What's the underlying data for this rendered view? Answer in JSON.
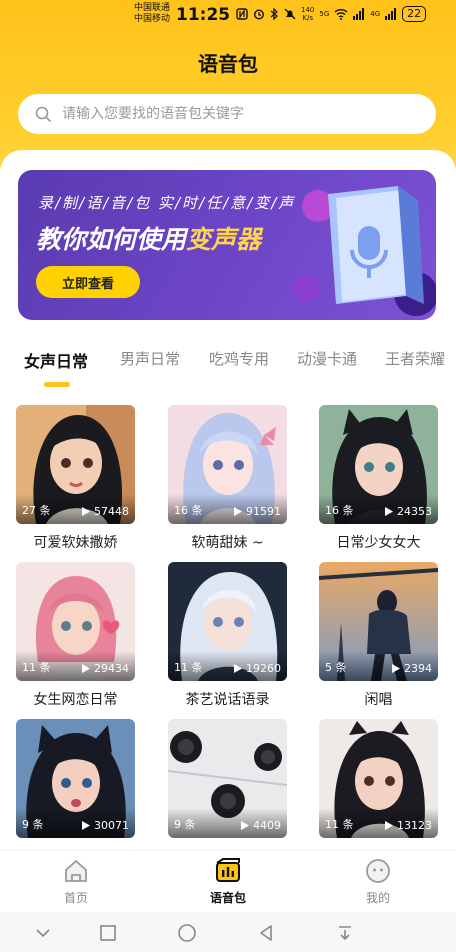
{
  "status_bar": {
    "carrier_1": "中国联通",
    "carrier_2": "中国移动",
    "time": "11:25",
    "net_speed_value": "140",
    "net_speed_unit": "K/s",
    "signal_1": "5G",
    "signal_2": "4G",
    "battery": "22"
  },
  "page": {
    "title": "语音包"
  },
  "search": {
    "placeholder": "请输入您要找的语音包关键字"
  },
  "banner": {
    "subtitle": "录/制/语/音/包   实/时/任/意/变/声",
    "headline_part1": "教你如何使用",
    "headline_part2": "变声器",
    "button": "立即查看"
  },
  "tabs": [
    {
      "label": "女声日常",
      "active": true
    },
    {
      "label": "男声日常",
      "active": false
    },
    {
      "label": "吃鸡专用",
      "active": false
    },
    {
      "label": "动漫卡通",
      "active": false
    },
    {
      "label": "王者荣耀",
      "active": false
    }
  ],
  "cards": [
    {
      "count": "27 条",
      "plays": "57448",
      "title": "可爱软妹撒娇"
    },
    {
      "count": "16 条",
      "plays": "91591",
      "title": "软萌甜妹 ~"
    },
    {
      "count": "16 条",
      "plays": "24353",
      "title": "日常少女女大"
    },
    {
      "count": "11 条",
      "plays": "29434",
      "title": "女生网恋日常"
    },
    {
      "count": "11 条",
      "plays": "19260",
      "title": "茶艺说话语录"
    },
    {
      "count": "5 条",
      "plays": "2394",
      "title": "闲唱"
    },
    {
      "count": "9 条",
      "plays": "30071",
      "title": ""
    },
    {
      "count": "9 条",
      "plays": "4409",
      "title": ""
    },
    {
      "count": "11 条",
      "plays": "13123",
      "title": ""
    }
  ],
  "bottom_nav": [
    {
      "label": "首页",
      "icon": "home-icon",
      "active": false
    },
    {
      "label": "语音包",
      "icon": "voice-pack-icon",
      "active": true
    },
    {
      "label": "我的",
      "icon": "profile-icon",
      "active": false
    }
  ],
  "colors": {
    "accent": "#ffc21a",
    "banner": "#6a44c4",
    "active_tab_indicator": "#ffc21a"
  }
}
